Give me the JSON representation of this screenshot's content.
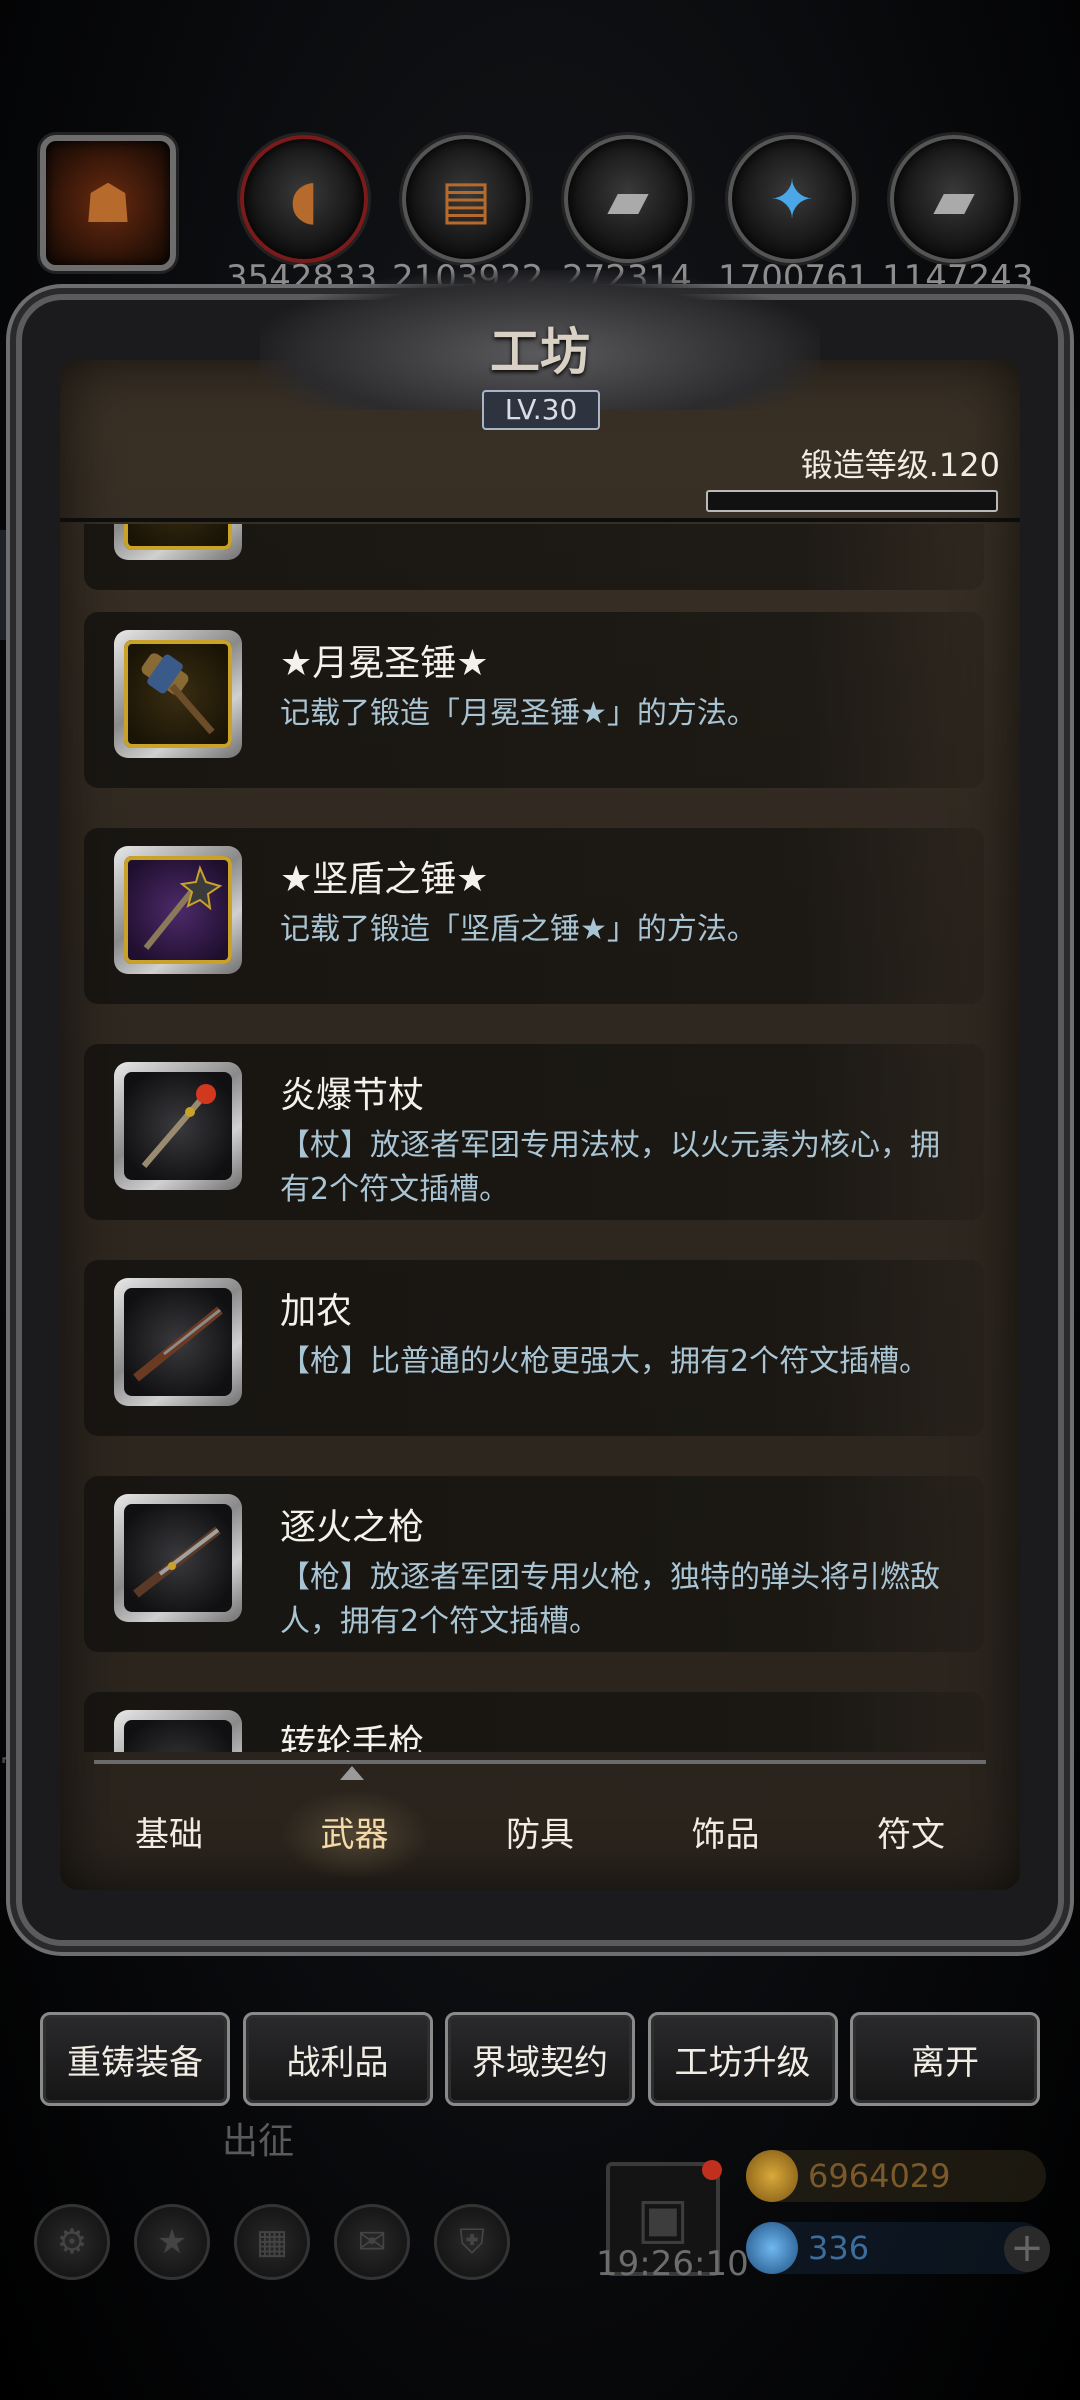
{
  "resources": [
    {
      "name": "pumpkin-resource",
      "count": ""
    },
    {
      "name": "meat-resource",
      "count": "3542833"
    },
    {
      "name": "wood-resource",
      "count": "2103922"
    },
    {
      "name": "iron-resource",
      "count": "272314"
    },
    {
      "name": "crystal-resource",
      "count": "1700761"
    },
    {
      "name": "steel-resource",
      "count": "1147243"
    }
  ],
  "header": {
    "title": "工坊",
    "level": "LV.30",
    "forge_level": "锻造等级.120",
    "forge_progress": 0
  },
  "items": [
    {
      "name": "★月冕圣锤★",
      "desc": "记载了锻造「月冕圣锤★」的方法。"
    },
    {
      "name": "★坚盾之锤★",
      "desc": "记载了锻造「坚盾之锤★」的方法。"
    },
    {
      "name": "炎爆节杖",
      "desc": "【杖】放逐者军团专用法杖，以火元素为核心，拥有2个符文插槽。"
    },
    {
      "name": "加农",
      "desc": "【枪】比普通的火枪更强大，拥有2个符文插槽。"
    },
    {
      "name": "逐火之枪",
      "desc": "【枪】放逐者军团专用火枪，独特的弹头将引燃敌人，拥有2个符文插槽。"
    },
    {
      "name": "转轮手枪",
      "desc": ""
    }
  ],
  "tabs": [
    "基础",
    "武器",
    "防具",
    "饰品",
    "符文"
  ],
  "active_tab": "武器",
  "buttons": [
    "重铸装备",
    "战利品",
    "界域契约",
    "工坊升级",
    "离开"
  ],
  "footer": {
    "chuzheng": "出征",
    "timer": "19:26:10",
    "gold": "6964029",
    "gems": "336"
  },
  "colors": {
    "desc_text": "#a9c4d3",
    "active_tab": "#f6d9a8"
  }
}
